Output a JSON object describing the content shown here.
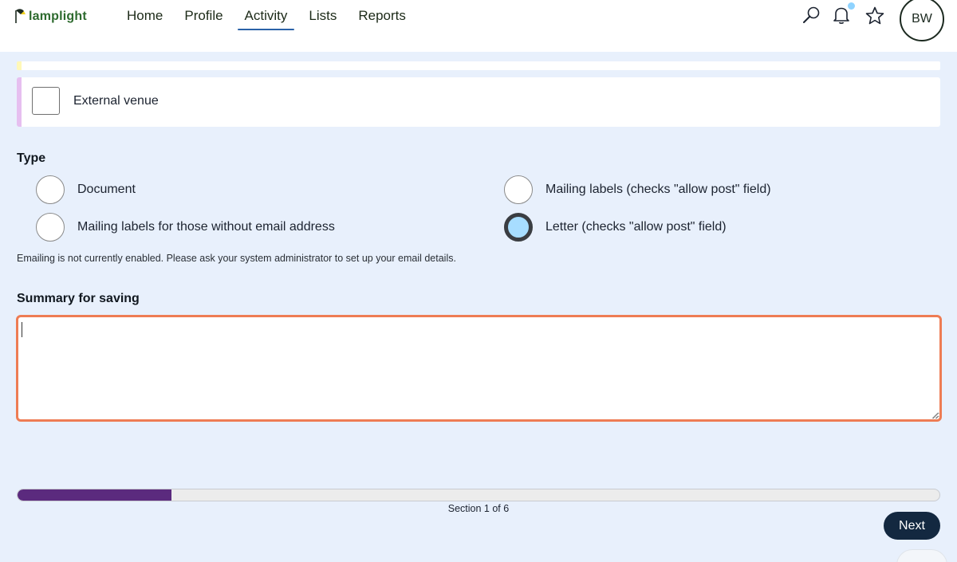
{
  "header": {
    "logo_text": "lamplight",
    "nav": [
      {
        "label": "Home",
        "active": false
      },
      {
        "label": "Profile",
        "active": false
      },
      {
        "label": "Activity",
        "active": true
      },
      {
        "label": "Lists",
        "active": false
      },
      {
        "label": "Reports",
        "active": false
      }
    ],
    "icons": [
      "search-icon",
      "notification-bell-icon",
      "favourites-star-icon"
    ],
    "avatar_initials": "BW",
    "colors": {
      "logo_green": "#2d6a2e",
      "active_underline": "#2a62a8",
      "notification_dot": "#8fd3ff"
    }
  },
  "venue": {
    "checkbox_label": "External venue",
    "checked": false
  },
  "type_section": {
    "title": "Type",
    "options": [
      {
        "label": "Document",
        "checked": false
      },
      {
        "label": "Mailing labels (checks \"allow post\" field)",
        "checked": false
      },
      {
        "label": "Mailing labels for those without email address",
        "checked": false
      },
      {
        "label": "Letter (checks \"allow post\" field)",
        "checked": true
      }
    ],
    "note": "Emailing is not currently enabled. Please ask your system administrator to set up your email details."
  },
  "summary": {
    "title": "Summary for saving",
    "value": "",
    "focus_color": "#ee7c54"
  },
  "progress": {
    "fraction": 0.1667,
    "text": "Section 1 of 6",
    "fill_color": "#5b2a7e"
  },
  "actions": {
    "next_label": "Next",
    "next_color": "#132840"
  }
}
